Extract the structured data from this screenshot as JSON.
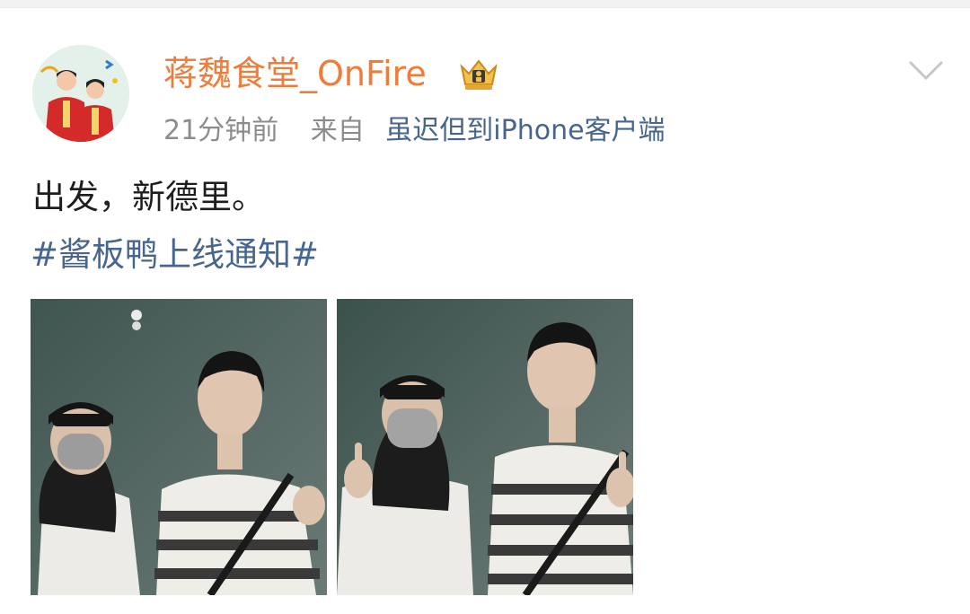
{
  "post": {
    "username": "蒋魏食堂_OnFire",
    "badge_icon": "crown-badge-icon",
    "time": "21分钟前",
    "source_prefix": "来自",
    "source_client": "虽迟但到iPhone客户端",
    "text": "出发，新德里。",
    "hashtag": "#酱板鸭上线通知#",
    "images": [
      {
        "icon": "photo-two-people-thumbnail-1"
      },
      {
        "icon": "photo-two-people-thumbnail-2"
      }
    ]
  },
  "colors": {
    "username": "#ee7c3a",
    "link": "#47658f",
    "meta": "#8c8c8c",
    "text": "#1e1e1e"
  }
}
